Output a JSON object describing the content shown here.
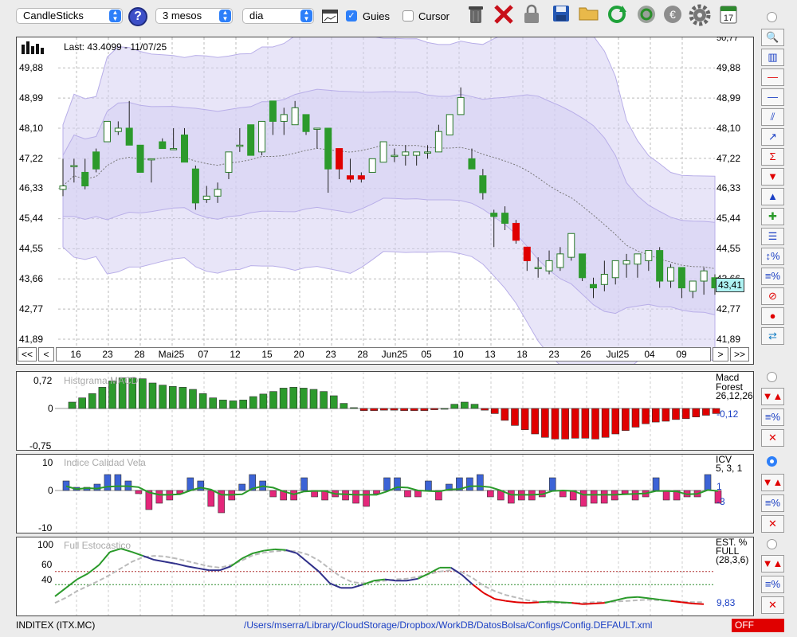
{
  "toolbar": {
    "chart_style": "CandleSticks",
    "period": "3 mesos",
    "interval": "dia",
    "guides_label": "Guies",
    "guides_checked": true,
    "cursor_label": "Cursor",
    "cursor_checked": false,
    "icons": [
      "help-icon",
      "calendar-view-icon",
      "trash-icon",
      "delete-icon",
      "lock-icon",
      "save-icon",
      "open-folder-icon",
      "refresh-icon",
      "update-icon",
      "currency-icon",
      "settings-icon",
      "calendar-icon"
    ],
    "calendar_day": "17"
  },
  "main_chart": {
    "last_label": "Last: 43.4099 - 11/07/25",
    "y_ticks": [
      "49,88",
      "48,99",
      "48,10",
      "47,22",
      "46,33",
      "45,44",
      "44,55",
      "43,66",
      "42,77",
      "41,89"
    ],
    "y_top_partial": "50,77",
    "current_value": "43,41",
    "date_labels": [
      "16",
      "23",
      "28",
      "Mai25",
      "07",
      "12",
      "15",
      "20",
      "23",
      "28",
      "Jun25",
      "05",
      "10",
      "13",
      "18",
      "23",
      "26",
      "Jul25",
      "04",
      "09"
    ],
    "nav_first": "<<",
    "nav_prev": "<",
    "nav_next": ">",
    "nav_last": ">>",
    "candles": [
      [
        46.3,
        47.2,
        46.1,
        46.4
      ],
      [
        47.0,
        47.2,
        46.5,
        47.0
      ],
      [
        46.8,
        47.2,
        46.3,
        46.4
      ],
      [
        47.4,
        47.5,
        46.8,
        46.9
      ],
      [
        47.7,
        48.3,
        47.7,
        48.3
      ],
      [
        48.0,
        48.3,
        47.9,
        48.1
      ],
      [
        48.1,
        48.9,
        47.6,
        47.6
      ],
      [
        47.6,
        47.6,
        46.8,
        46.8
      ],
      [
        47.2,
        47.2,
        46.5,
        47.2
      ],
      [
        47.7,
        47.8,
        47.5,
        47.5
      ],
      [
        47.5,
        48.1,
        47.5,
        47.5
      ],
      [
        47.9,
        48.1,
        47.1,
        47.1
      ],
      [
        46.9,
        47.0,
        45.7,
        45.9
      ],
      [
        46.0,
        46.4,
        45.9,
        46.1
      ],
      [
        46.1,
        46.5,
        45.9,
        46.3
      ],
      [
        46.8,
        47.4,
        46.6,
        47.4
      ],
      [
        47.6,
        48.1,
        47.4,
        47.6
      ],
      [
        48.2,
        48.2,
        47.3,
        47.3
      ],
      [
        47.4,
        48.3,
        47.3,
        48.3
      ],
      [
        48.9,
        48.9,
        47.9,
        48.3
      ],
      [
        48.3,
        48.7,
        47.9,
        48.5
      ],
      [
        48.2,
        48.9,
        48.2,
        48.7
      ],
      [
        48.5,
        48.5,
        47.9,
        48.0
      ],
      [
        48.1,
        48.1,
        47.5,
        48.1
      ],
      [
        48.1,
        48.1,
        46.2,
        46.9
      ],
      [
        47.5,
        47.5,
        46.6,
        46.9
      ],
      [
        46.7,
        47.2,
        46.5,
        46.6
      ],
      [
        46.7,
        46.8,
        46.5,
        46.6
      ],
      [
        46.8,
        47.2,
        46.8,
        47.2
      ],
      [
        47.1,
        47.7,
        47.1,
        47.7
      ],
      [
        47.3,
        47.5,
        47.1,
        47.3
      ],
      [
        47.3,
        47.6,
        47.0,
        47.4
      ],
      [
        47.3,
        47.4,
        47.0,
        47.4
      ],
      [
        47.4,
        47.6,
        47.2,
        47.4
      ],
      [
        47.4,
        48.2,
        47.4,
        48.0
      ],
      [
        47.9,
        48.5,
        47.9,
        48.5
      ],
      [
        48.5,
        49.3,
        48.5,
        49.0
      ],
      [
        47.2,
        47.5,
        46.9,
        46.9
      ],
      [
        46.7,
        46.9,
        46.0,
        46.2
      ],
      [
        45.6,
        45.7,
        44.6,
        45.5
      ],
      [
        45.6,
        45.8,
        45.1,
        45.3
      ],
      [
        45.3,
        45.4,
        44.7,
        44.8
      ],
      [
        44.6,
        44.6,
        43.9,
        44.2
      ],
      [
        44.0,
        44.3,
        43.7,
        44.0
      ],
      [
        43.9,
        44.5,
        43.8,
        44.2
      ],
      [
        44.0,
        44.6,
        43.9,
        44.4
      ],
      [
        44.3,
        45.0,
        44.2,
        45.0
      ],
      [
        44.4,
        44.4,
        43.6,
        43.7
      ],
      [
        43.5,
        43.7,
        43.1,
        43.4
      ],
      [
        43.5,
        44.2,
        43.3,
        43.8
      ],
      [
        43.7,
        44.2,
        43.5,
        44.2
      ],
      [
        44.1,
        44.4,
        43.7,
        44.2
      ],
      [
        44.1,
        44.3,
        43.7,
        44.4
      ],
      [
        44.2,
        44.5,
        43.9,
        44.5
      ],
      [
        44.5,
        44.6,
        43.4,
        43.6
      ],
      [
        43.6,
        44.1,
        43.4,
        44.0
      ],
      [
        44.0,
        44.0,
        43.1,
        43.4
      ],
      [
        43.3,
        43.6,
        43.1,
        43.6
      ],
      [
        43.6,
        44.0,
        43.2,
        43.9
      ],
      [
        43.7,
        43.8,
        43.2,
        43.4
      ]
    ],
    "colors": {
      "up_body": "#ffffff",
      "down_body": "#2c9a2c",
      "red_body": "#e00000",
      "band_fill": "#d6d0f3"
    }
  },
  "macd_panel": {
    "title": "Histgrama MACD",
    "name": "Macd",
    "subname": "Forest",
    "params": "26,12,26",
    "value": "-0,12",
    "y_top": "0,72",
    "y_zero": "0",
    "y_bottom": "-0,75",
    "values": [
      0.15,
      0.25,
      0.35,
      0.5,
      0.65,
      0.72,
      0.72,
      0.7,
      0.6,
      0.55,
      0.52,
      0.5,
      0.45,
      0.35,
      0.25,
      0.2,
      0.18,
      0.2,
      0.28,
      0.34,
      0.4,
      0.48,
      0.5,
      0.48,
      0.45,
      0.4,
      0.3,
      0.12,
      0.02,
      -0.05,
      -0.05,
      -0.04,
      -0.04,
      -0.05,
      -0.05,
      -0.05,
      -0.03,
      0.0,
      0.1,
      0.15,
      0.1,
      -0.04,
      -0.12,
      -0.28,
      -0.4,
      -0.5,
      -0.6,
      -0.68,
      -0.72,
      -0.72,
      -0.7,
      -0.7,
      -0.72,
      -0.68,
      -0.6,
      -0.52,
      -0.44,
      -0.36,
      -0.32,
      -0.3,
      -0.26,
      -0.24,
      -0.2,
      -0.16,
      -0.12
    ]
  },
  "icv_panel": {
    "title": "Indice Calidad Vela",
    "name": "ICV",
    "params": "5, 3, 1",
    "value_pos": "1",
    "value_neg": "-3",
    "y_top": "10",
    "y_zero": "0",
    "y_bottom": "-10",
    "values": [
      3,
      1,
      1,
      2,
      5,
      5,
      3,
      -1,
      -6,
      -4,
      -3,
      -1,
      4,
      3,
      -5,
      -7,
      -3,
      2,
      5,
      3,
      -2,
      -3,
      -3,
      4,
      -2,
      -3,
      -2,
      -3,
      -4,
      -5,
      -1,
      4,
      4,
      -2,
      -2,
      3,
      -3,
      2,
      4,
      4,
      5,
      -2,
      -3,
      -4,
      -3,
      -3,
      -2,
      4,
      -2,
      -3,
      -5,
      -4,
      -4,
      -3,
      -1,
      -3,
      -2,
      4,
      -3,
      -3,
      -2,
      -2,
      5,
      -4
    ]
  },
  "stoch_panel": {
    "title": "Full Estocastico",
    "name": "EST. %",
    "subname": "FULL",
    "params": "(28,3,6)",
    "value": "9,83",
    "y_labels": [
      "100",
      "60",
      "40"
    ],
    "k_line": [
      22,
      35,
      48,
      57,
      70,
      90,
      95,
      90,
      84,
      78,
      75,
      72,
      68,
      65,
      62,
      62,
      68,
      80,
      88,
      92,
      94,
      93,
      88,
      74,
      60,
      42,
      35,
      35,
      40,
      46,
      48,
      46,
      46,
      49,
      57,
      66,
      66,
      55,
      40,
      27,
      18,
      15,
      13,
      12,
      13,
      14,
      13,
      12,
      10,
      11,
      12,
      16,
      20,
      21,
      19,
      17,
      15,
      13,
      11,
      10
    ],
    "d_line": [
      12,
      20,
      30,
      38,
      46,
      55,
      65,
      75,
      82,
      84,
      83,
      80,
      76,
      72,
      68,
      66,
      70,
      77,
      85,
      89,
      91,
      92,
      91,
      86,
      77,
      64,
      52,
      44,
      42,
      44,
      46,
      48,
      49,
      52,
      56,
      60,
      62,
      59,
      50,
      38,
      30,
      24,
      20,
      16,
      14,
      12,
      12,
      12,
      12,
      13,
      13,
      14,
      15,
      16,
      17,
      16,
      15,
      14,
      13,
      13
    ]
  },
  "right_strip": {
    "main_buttons": [
      "zoom-icon",
      "bar-chart-icon",
      "horizontal-line-icon",
      "blue-line-icon",
      "trend-channel-icon",
      "trendline-icon",
      "sigma-icon",
      "sell-arrow-icon",
      "buy-arrow-icon",
      "signals-icon",
      "lines-list-icon",
      "range-percent-icon",
      "percent-lines-icon",
      "stop-icon",
      "record-icon",
      "swap-icon"
    ],
    "macd_buttons": [
      "arrows-icon",
      "percent-lines-icon",
      "crossover-icon"
    ],
    "icv_buttons": [
      "arrows-icon",
      "percent-lines-icon",
      "crossover-icon"
    ],
    "stoch_buttons": [
      "arrows-icon",
      "percent-lines-icon",
      "crossover-icon"
    ]
  },
  "status_bar": {
    "symbol": "INDITEX (ITX.MC)",
    "path": "/Users/mserra/Library/CloudStorage/Dropbox/WorkDB/DatosBolsa/Configs/Config.DEFAULT.xml",
    "off_label": "OFF",
    "off_color": "#e00000"
  }
}
